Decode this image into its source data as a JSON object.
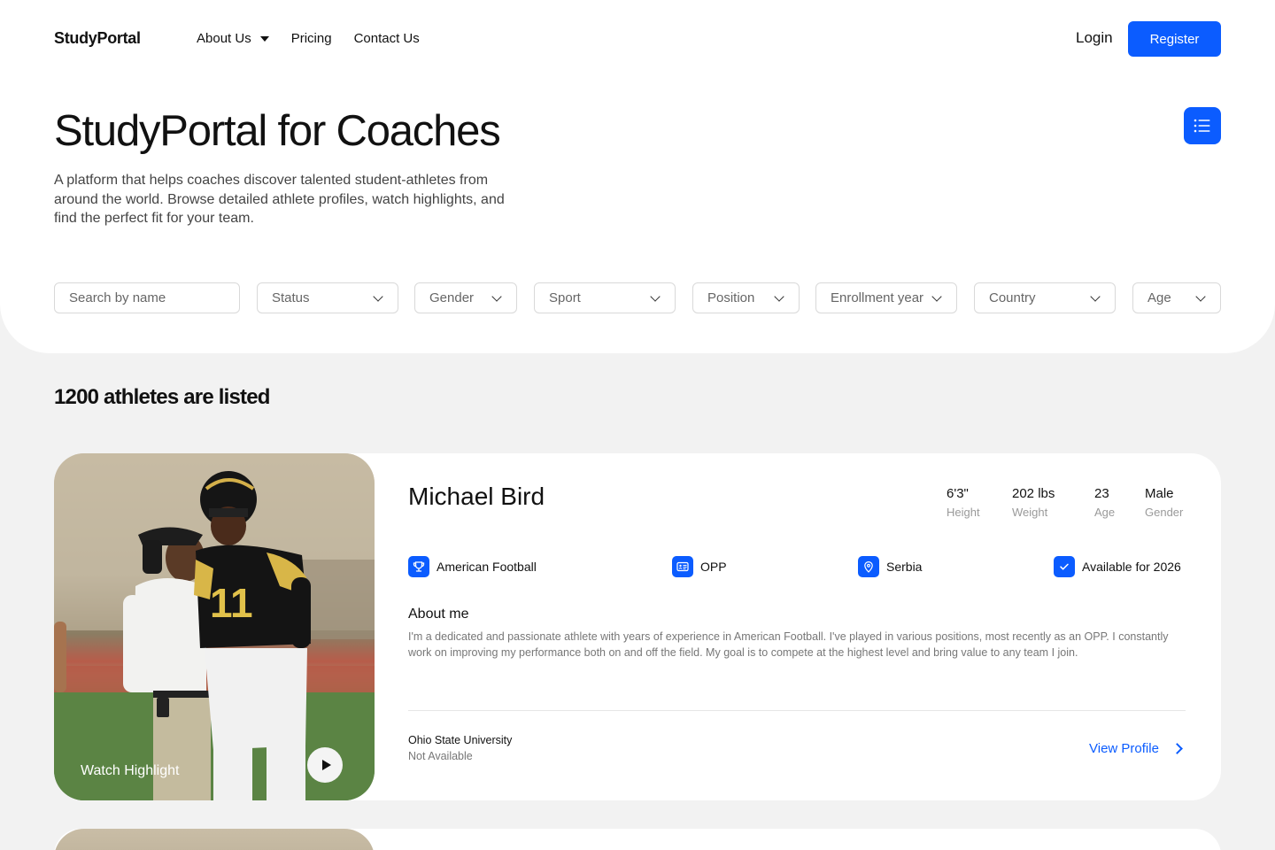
{
  "header": {
    "brand": "StudyPortal",
    "nav": [
      "About Us",
      "Pricing",
      "Contact Us"
    ],
    "login": "Login",
    "register": "Register"
  },
  "hero": {
    "title": "StudyPortal for Coaches",
    "description": "A platform that helps coaches discover talented student-athletes from around the world. Browse detailed athlete profiles, watch highlights, and find the perfect fit for your team."
  },
  "filters": {
    "search_placeholder": "Search by name",
    "selects": [
      "Status",
      "Gender",
      "Sport",
      "Position",
      "Enrollment year",
      "Country",
      "Age"
    ]
  },
  "listing": {
    "count_text": "1200 athletes are listed"
  },
  "athlete": {
    "name": "Michael Bird",
    "watch_label": "Watch Highlight",
    "stats": [
      {
        "value": "6'3\"",
        "label": "Height"
      },
      {
        "value": "202 lbs",
        "label": "Weight"
      },
      {
        "value": "23",
        "label": "Age"
      },
      {
        "value": "Male",
        "label": "Gender"
      }
    ],
    "tags": [
      {
        "label": "American Football",
        "icon": "trophy-icon"
      },
      {
        "label": "OPP",
        "icon": "id-card-icon"
      },
      {
        "label": "Serbia",
        "icon": "location-pin-icon"
      },
      {
        "label": "Available for 2026",
        "icon": "checkbox-icon"
      }
    ],
    "about_title": "About me",
    "about_text": "I'm a dedicated and passionate athlete with years of experience in American Football. I've played in various positions, most recently as an OPP. I constantly work on improving my performance both on and off the field. My goal is to compete at the highest level and bring value to any team I join.",
    "university": "Ohio State University",
    "university_status": "Not Available",
    "view_profile": "View Profile"
  },
  "colors": {
    "accent": "#0b5cff",
    "page_bg": "#f2f2f2",
    "card_bg": "#ffffff"
  }
}
